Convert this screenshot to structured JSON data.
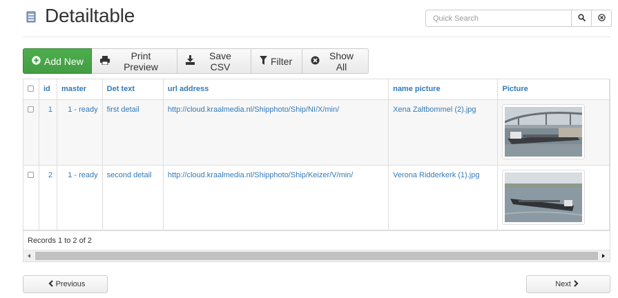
{
  "header": {
    "title": "Detailtable",
    "icon": "table-page-icon"
  },
  "search": {
    "placeholder": "Quick Search",
    "value": ""
  },
  "toolbar": {
    "add_new": "Add New",
    "print_preview": "Print Preview",
    "save_csv": "Save CSV",
    "filter": "Filter",
    "show_all": "Show All",
    "accent_color": "#449d44"
  },
  "table": {
    "columns": {
      "id": "id",
      "master": "master",
      "det_text": "Det text",
      "url_address": "url address",
      "name_picture": "name picture",
      "picture": "Picture"
    },
    "rows": [
      {
        "id": "1",
        "master": "1 - ready",
        "det_text": "first detail",
        "url_address": "http://cloud.kraalmedia.nl/Shipphoto/Ship/NI/X/min/",
        "name_picture": "Xena Zaltbommel (2).jpg",
        "picture": "ship-photo-thumbnail"
      },
      {
        "id": "2",
        "master": "1 - ready",
        "det_text": "second detail",
        "url_address": "http://cloud.kraalmedia.nl/Shipphoto/Ship/Keizer/V/min/",
        "name_picture": "Verona Ridderkerk (1).jpg",
        "picture": "ship-photo-thumbnail"
      }
    ],
    "records_text": "Records 1 to 2 of 2",
    "link_color": "#337ab7"
  },
  "pager": {
    "previous": "Previous",
    "next": "Next"
  }
}
